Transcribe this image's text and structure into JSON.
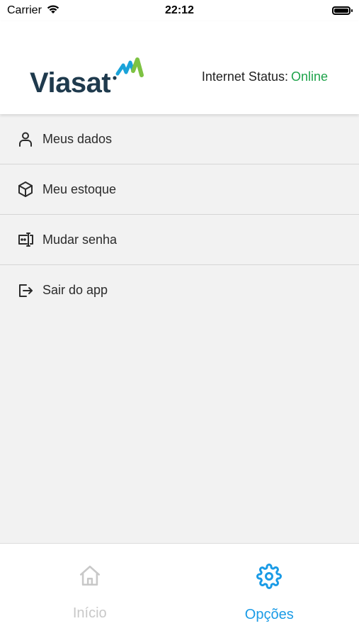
{
  "status_bar": {
    "carrier": "Carrier",
    "time": "22:12"
  },
  "header": {
    "logo_text": "Viasat",
    "internet_status_label": "Internet Status:",
    "internet_status_value": "Online"
  },
  "menu": {
    "items": [
      {
        "label": "Meus dados",
        "icon": "user-icon"
      },
      {
        "label": "Meu estoque",
        "icon": "box-icon"
      },
      {
        "label": "Mudar senha",
        "icon": "password-icon"
      },
      {
        "label": "Sair do app",
        "icon": "logout-icon"
      }
    ]
  },
  "tab_bar": {
    "tabs": [
      {
        "label": "Início",
        "icon": "home-icon",
        "active": false
      },
      {
        "label": "Opções",
        "icon": "gear-icon",
        "active": true
      }
    ]
  },
  "colors": {
    "online": "#1ea34a",
    "active_tab": "#1a9be6",
    "inactive_tab": "#c8c8c8",
    "logo_dark": "#1f3a4d"
  }
}
